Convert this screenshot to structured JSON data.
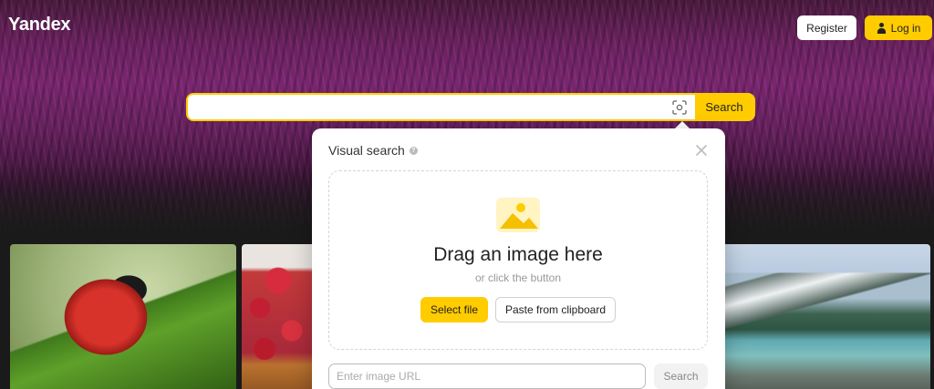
{
  "header": {
    "logo": "Yandex",
    "register_label": "Register",
    "login_label": "Log in"
  },
  "search": {
    "value": "",
    "placeholder": "",
    "button_label": "Search"
  },
  "visual_search": {
    "title": "Visual search",
    "help_glyph": "?",
    "drop_title": "Drag an image here",
    "drop_subtitle": "or click the button",
    "select_file_label": "Select file",
    "paste_label": "Paste from clipboard",
    "url_placeholder": "Enter image URL",
    "url_search_label": "Search"
  },
  "colors": {
    "accent": "#ffcc00",
    "hero": "#6b2160"
  },
  "icons": [
    "user-icon",
    "camera-icon",
    "help-icon",
    "close-icon",
    "image-icon"
  ]
}
